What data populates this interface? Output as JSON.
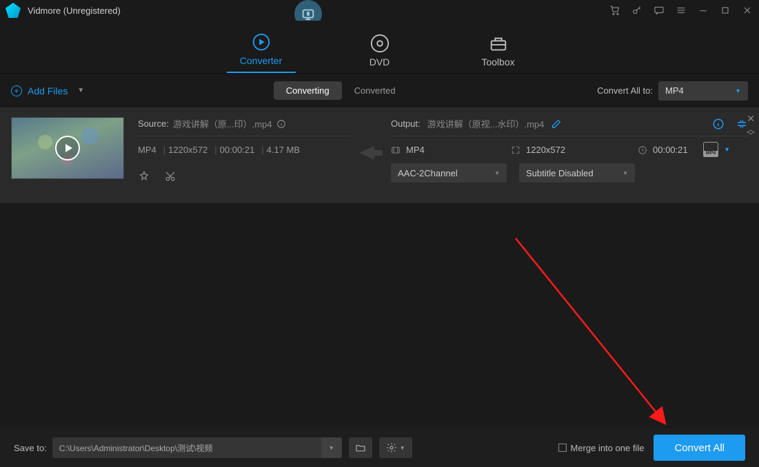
{
  "title": "Vidmore (Unregistered)",
  "nav": {
    "converter": "Converter",
    "dvd": "DVD",
    "toolbox": "Toolbox"
  },
  "subbar": {
    "add_files": "Add Files",
    "converting": "Converting",
    "converted": "Converted",
    "convert_all_to": "Convert All to:",
    "format": "MP4"
  },
  "file": {
    "source_label": "Source:",
    "source_name": "游戏讲解（原...印）.mp4",
    "src_fmt": "MP4",
    "src_res": "1220x572",
    "src_dur": "00:00:21",
    "src_size": "4.17 MB",
    "output_label": "Output:",
    "output_name": "游戏讲解（原视...水印）.mp4",
    "out_fmt": "MP4",
    "out_res": "1220x572",
    "out_dur": "00:00:21",
    "audio_sel": "AAC-2Channel",
    "subtitle_sel": "Subtitle Disabled",
    "badge": "MP4"
  },
  "footer": {
    "save_to": "Save to:",
    "path": "C:\\Users\\Administrator\\Desktop\\测试\\视频",
    "merge": "Merge into one file",
    "convert_all": "Convert All"
  }
}
